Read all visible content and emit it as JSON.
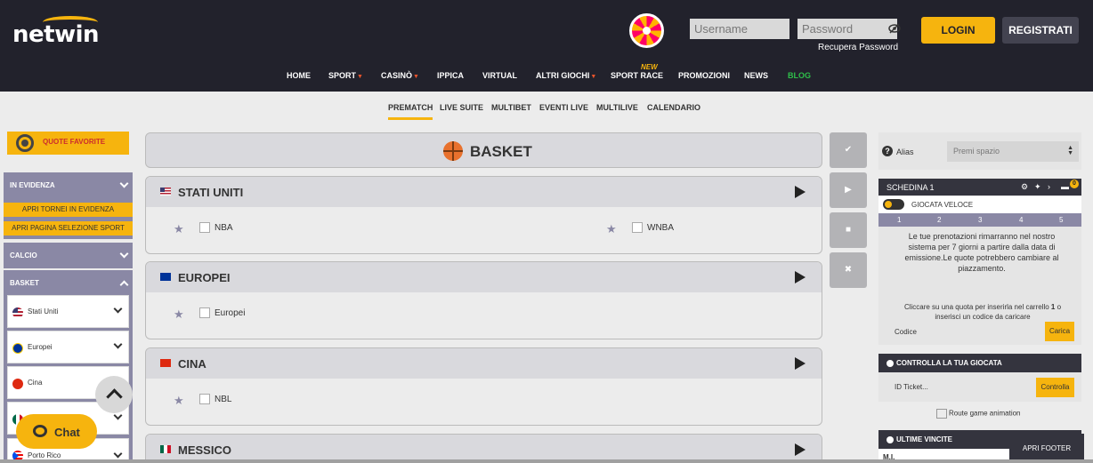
{
  "header": {
    "logo": "netwin",
    "username_placeholder": "Username",
    "password_placeholder": "Password",
    "recupera_password": "Recupera Password",
    "login": "LOGIN",
    "registrati": "REGISTRATI",
    "nav": [
      {
        "label": "HOME"
      },
      {
        "label": "SPORT"
      },
      {
        "label": "CASINÒ"
      },
      {
        "label": "IPPICA"
      },
      {
        "label": "VIRTUAL"
      },
      {
        "label": "ALTRI GIOCHI"
      },
      {
        "label": "SPORT RACE"
      },
      {
        "label": "PROMOZIONI"
      },
      {
        "label": "NEWS"
      },
      {
        "label": "BLOG"
      }
    ],
    "new_badge": "NEW",
    "colors": {
      "accent": "#f6b40e",
      "dark": "#22222c",
      "blog": "#2fbf4a",
      "arrow": "#e8542b"
    }
  },
  "subnav": [
    {
      "label": "PREMATCH",
      "active": true
    },
    {
      "label": "LIVE SUITE"
    },
    {
      "label": "MULTIBET"
    },
    {
      "label": "EVENTI LIVE"
    },
    {
      "label": "MULTILIVE"
    },
    {
      "label": "CALENDARIO"
    }
  ],
  "sidebar": {
    "quote_favorite": "QUOTE FAVORITE",
    "in_evidenza": "IN EVIDENZA",
    "apri_tornei": "APRI TORNEI IN EVIDENZA",
    "apri_pagina": "APRI PAGINA SELEZIONE SPORT",
    "calcio": "CALCIO",
    "basket": "BASKET",
    "basket_items": [
      {
        "label": "Stati Uniti"
      },
      {
        "label": "Europei"
      },
      {
        "label": "Cina"
      },
      {
        "label": ""
      },
      {
        "label": "Porto Rico"
      }
    ],
    "chat": "Chat"
  },
  "main": {
    "sport_title": "BASKET",
    "regions": [
      {
        "name": "STATI UNITI",
        "competitions": [
          "NBA",
          "WNBA"
        ]
      },
      {
        "name": "EUROPEI",
        "competitions": [
          "Europei"
        ]
      },
      {
        "name": "CINA",
        "competitions": [
          "NBL"
        ]
      },
      {
        "name": "MESSICO",
        "competitions": []
      }
    ]
  },
  "tools": [
    "check-icon",
    "play-icon",
    "print-icon",
    "close-icon"
  ],
  "right": {
    "alias_label": "Alias",
    "alias_placeholder": "Premi spazio",
    "schedina_title": "SCHEDINA 1",
    "badge_count": "0",
    "giocata_veloce": "GIOCATA VELOCE",
    "tabs": [
      "1",
      "2",
      "3",
      "4",
      "5"
    ],
    "message": "Le tue prenotazioni rimarranno nel nostro sistema per 7 giorni a partire dalla data di emissione.Le quote potrebbero cambiare al piazzamento.",
    "message2_pre": "Cliccare su una quota per inserirla nel carrello",
    "message2_bold": "1",
    "message2_post": "o inserisci un codice da caricare",
    "codice": "Codice",
    "carica": "Carica",
    "controlla_title": "CONTROLLA LA TUA GIOCATA",
    "ticket_placeholder": "ID Ticket...",
    "controlla_btn": "Controlla",
    "route_alt": "Route game animation",
    "ultime_vincite": "ULTIME VINCITE",
    "vincite_text": "M.I.",
    "apri_footer": "APRI FOOTER"
  }
}
